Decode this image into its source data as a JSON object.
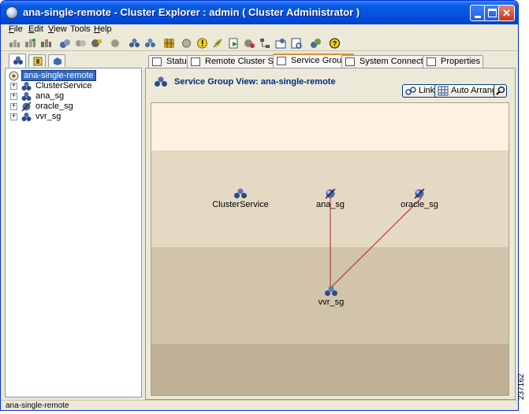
{
  "window": {
    "title": "ana-single-remote - Cluster Explorer : admin ( Cluster Administrator )",
    "minimize_label": "_",
    "maximize_label": "□",
    "close_label": "✕"
  },
  "menu": [
    {
      "label": "File",
      "mnemonic": "F",
      "rest": "ile"
    },
    {
      "label": "Edit",
      "mnemonic": "E",
      "rest": "dit"
    },
    {
      "label": "View",
      "mnemonic": "V",
      "rest": "iew"
    },
    {
      "label": "Tools",
      "mnemonic": "T",
      "rest": "ools",
      "full": "Tools"
    },
    {
      "label": "Help",
      "mnemonic": "H",
      "rest": "elp"
    }
  ],
  "toolbar_icons": [
    "add-service-group-icon",
    "online-icon",
    "offline-icon",
    "add-resource-icon",
    "link-icon",
    "configure-icon",
    "system-icon",
    "cluster-icon",
    "configuration-wizard-icon",
    "grid-icon",
    "record-icon",
    "info-icon",
    "lightning-icon",
    "export-icon",
    "notify-icon",
    "tree-icon",
    "remote-group-icon",
    "report-icon",
    "query-icon",
    "help-icon"
  ],
  "left_tabs": [
    "service-groups-tab-icon",
    "systems-tab-icon",
    "resources-tab-icon"
  ],
  "tree": {
    "root": "ana-single-remote",
    "items": [
      "ClusterService",
      "ana_sg",
      "oracle_sg",
      "vvr_sg"
    ]
  },
  "tabs": [
    {
      "label": "Status",
      "icon": "status-icon"
    },
    {
      "label": "Remote Cluster Status",
      "icon": "remote-status-icon"
    },
    {
      "label": "Service Groups",
      "icon": "service-groups-icon",
      "active": true
    },
    {
      "label": "System Connectivity",
      "icon": "connectivity-icon"
    },
    {
      "label": "Properties",
      "icon": "properties-icon"
    }
  ],
  "view": {
    "title": "Service Group View: ana-single-remote",
    "link_button": "Link",
    "auto_arrange_button": "Auto Arrange",
    "zoom_icon": "magnifier-icon"
  },
  "graph": {
    "nodes": [
      {
        "id": "ClusterService",
        "label": "ClusterService",
        "icon": "service-group-icon"
      },
      {
        "id": "ana_sg",
        "label": "ana_sg",
        "icon": "remote-service-group-icon"
      },
      {
        "id": "oracle_sg",
        "label": "oracle_sg",
        "icon": "remote-service-group-icon"
      },
      {
        "id": "vvr_sg",
        "label": "vvr_sg",
        "icon": "service-group-icon"
      }
    ],
    "edges": [
      {
        "from": "ana_sg",
        "to": "vvr_sg"
      },
      {
        "from": "oracle_sg",
        "to": "vvr_sg"
      }
    ],
    "band_colors": [
      "#fdf2e2",
      "#e4d9c3",
      "#d1c4ab",
      "#bfb096"
    ],
    "edge_color": "#b22222"
  },
  "status_bar": "ana-single-remote",
  "figure_number": "237162"
}
